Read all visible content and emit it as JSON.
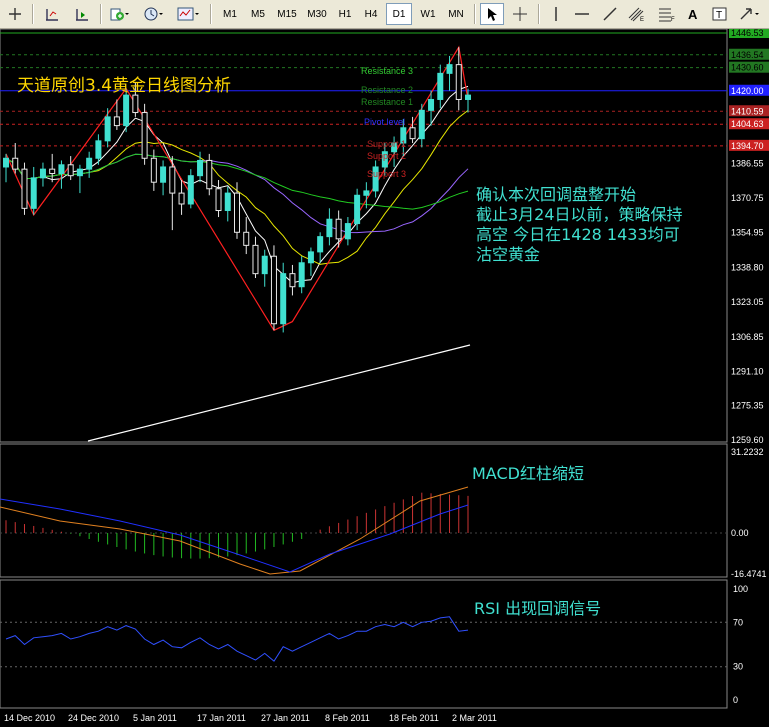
{
  "toolbar": {
    "timeframes": [
      "M1",
      "M5",
      "M15",
      "M30",
      "H1",
      "H4",
      "D1",
      "W1",
      "MN"
    ],
    "active_timeframe": "D1"
  },
  "annotations": {
    "title": "天道原创3.4黄金日线图分析",
    "main_line1": "确认本次回调盘整开始",
    "main_line2": "截止3月24日以前，策略保持",
    "main_line3": "高空   今日在1428   1433均可",
    "main_line4": "沽空黄金",
    "macd_note": "MACD红柱缩短",
    "rsi_note": "RSI 出现回调信号"
  },
  "levels": {
    "resistance3": "Resistance 3",
    "resistance2": "Resistance 2",
    "resistance1": "Resistance 1",
    "pivot": "Pivot level",
    "support1": "Support 1",
    "support2": "Support 2",
    "support3": "Support 3"
  },
  "price_axis": [
    "1446.53",
    "1436.54",
    "1430.60",
    "1420.00",
    "1410.59",
    "1404.63",
    "1394.70",
    "1386.55",
    "1370.75",
    "1354.95",
    "1338.80",
    "1323.05",
    "1306.85",
    "1291.10",
    "1275.35",
    "1259.60"
  ],
  "macd_axis": [
    "31.2232",
    "0.00",
    "-16.4741"
  ],
  "rsi_axis": [
    "100",
    "70",
    "30",
    "0"
  ],
  "date_axis": [
    "14 Dec 2010",
    "24 Dec 2010",
    "5 Jan 2011",
    "17 Jan 2011",
    "27 Jan 2011",
    "8 Feb 2011",
    "18 Feb 2011",
    "2 Mar 2011"
  ],
  "colors": {
    "bull_candle": "#40e0d0",
    "bear_candle": "#e8e8e8",
    "zigzag": "#ff2020",
    "pivot": "#2020ff",
    "resistance": "#22aa22",
    "support": "#cc2222",
    "annotation_text": "#40e0d0",
    "title_text": "#ffd700"
  },
  "chart_data": {
    "type": "candlestick",
    "symbol": "XAUUSD",
    "timeframe": "D1",
    "price_range": [
      1259.6,
      1446.53
    ],
    "candles": [
      [
        1385,
        1391,
        1378,
        1389
      ],
      [
        1389,
        1396,
        1382,
        1384
      ],
      [
        1384,
        1387,
        1363,
        1366
      ],
      [
        1366,
        1385,
        1363,
        1380
      ],
      [
        1380,
        1387,
        1376,
        1384
      ],
      [
        1384,
        1391,
        1378,
        1382
      ],
      [
        1382,
        1388,
        1375,
        1386
      ],
      [
        1386,
        1390,
        1379,
        1381
      ],
      [
        1381,
        1386,
        1373,
        1384
      ],
      [
        1384,
        1392,
        1380,
        1389
      ],
      [
        1389,
        1400,
        1386,
        1397
      ],
      [
        1397,
        1412,
        1394,
        1408
      ],
      [
        1408,
        1416,
        1402,
        1404
      ],
      [
        1404,
        1421,
        1401,
        1418
      ],
      [
        1418,
        1424,
        1408,
        1410
      ],
      [
        1410,
        1414,
        1386,
        1389
      ],
      [
        1389,
        1393,
        1374,
        1378
      ],
      [
        1378,
        1388,
        1372,
        1385
      ],
      [
        1385,
        1390,
        1356,
        1373
      ],
      [
        1373,
        1379,
        1363,
        1368
      ],
      [
        1368,
        1384,
        1366,
        1381
      ],
      [
        1381,
        1392,
        1378,
        1388
      ],
      [
        1388,
        1391,
        1372,
        1375
      ],
      [
        1375,
        1379,
        1362,
        1365
      ],
      [
        1365,
        1376,
        1360,
        1373
      ],
      [
        1373,
        1378,
        1352,
        1355
      ],
      [
        1355,
        1362,
        1345,
        1349
      ],
      [
        1349,
        1353,
        1334,
        1336
      ],
      [
        1336,
        1347,
        1330,
        1344
      ],
      [
        1344,
        1349,
        1310,
        1313
      ],
      [
        1313,
        1341,
        1309,
        1336
      ],
      [
        1336,
        1340,
        1326,
        1330
      ],
      [
        1330,
        1344,
        1327,
        1341
      ],
      [
        1341,
        1348,
        1335,
        1346
      ],
      [
        1346,
        1355,
        1341,
        1353
      ],
      [
        1353,
        1366,
        1349,
        1361
      ],
      [
        1361,
        1365,
        1348,
        1352
      ],
      [
        1352,
        1362,
        1349,
        1359
      ],
      [
        1359,
        1375,
        1356,
        1372
      ],
      [
        1372,
        1378,
        1366,
        1374
      ],
      [
        1374,
        1388,
        1371,
        1385
      ],
      [
        1385,
        1396,
        1381,
        1392
      ],
      [
        1392,
        1399,
        1385,
        1396
      ],
      [
        1396,
        1407,
        1390,
        1403
      ],
      [
        1403,
        1408,
        1396,
        1398
      ],
      [
        1398,
        1414,
        1394,
        1411
      ],
      [
        1411,
        1420,
        1404,
        1416
      ],
      [
        1416,
        1432,
        1412,
        1428
      ],
      [
        1428,
        1436,
        1420,
        1432
      ],
      [
        1432,
        1440,
        1411,
        1416
      ],
      [
        1416,
        1421,
        1410,
        1418
      ]
    ]
  }
}
